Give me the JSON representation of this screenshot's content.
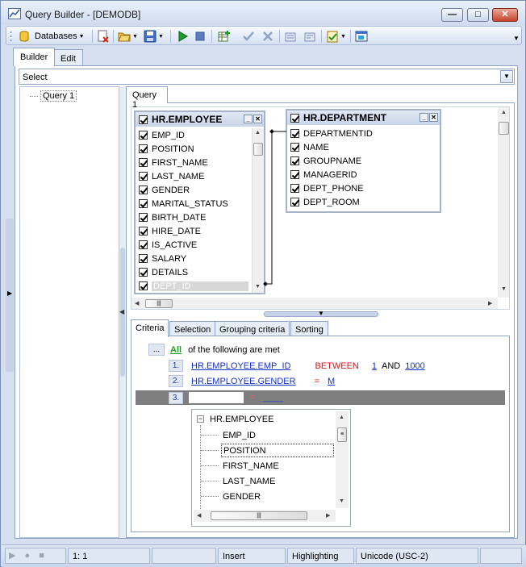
{
  "window": {
    "title": "Query Builder - [DEMODB]"
  },
  "caption_buttons": {
    "minimize": "—",
    "maximize": "□",
    "close": "✕"
  },
  "toolbar": {
    "databases_label": "Databases"
  },
  "main_tabs": [
    {
      "label": "Builder"
    },
    {
      "label": "Edit"
    }
  ],
  "query_type": {
    "value": "Select"
  },
  "query_tree": {
    "items": [
      {
        "label": "Query 1"
      }
    ]
  },
  "query_tab": {
    "label": "Query 1"
  },
  "tables": [
    {
      "title": "HR.EMPLOYEE",
      "fields": [
        "EMP_ID",
        "POSITION",
        "FIRST_NAME",
        "LAST_NAME",
        "GENDER",
        "MARITAL_STATUS",
        "BIRTH_DATE",
        "HIRE_DATE",
        "IS_ACTIVE",
        "SALARY",
        "DETAILS",
        "DEPT_ID"
      ]
    },
    {
      "title": "HR.DEPARTMENT",
      "fields": [
        "DEPARTMENTID",
        "NAME",
        "GROUPNAME",
        "MANAGERID",
        "DEPT_PHONE",
        "DEPT_ROOM"
      ]
    }
  ],
  "criteria_tabs": [
    {
      "label": "Criteria"
    },
    {
      "label": "Selection"
    },
    {
      "label": "Grouping criteria"
    },
    {
      "label": "Sorting"
    }
  ],
  "criteria": {
    "ellipsis": "...",
    "quantifier": "All",
    "tail": "of the following are met",
    "rows": [
      {
        "num": "1.",
        "field": "HR.EMPLOYEE.EMP_ID",
        "op": "BETWEEN",
        "v1": "1",
        "and": "AND",
        "v2": "1000"
      },
      {
        "num": "2.",
        "field": "HR.EMPLOYEE.GENDER",
        "op": "=",
        "v1": "M"
      },
      {
        "num": "3.",
        "field": "",
        "op": "=",
        "v1": "____"
      }
    ]
  },
  "field_dropdown": {
    "root": "HR.EMPLOYEE",
    "items": [
      "EMP_ID",
      "POSITION",
      "FIRST_NAME",
      "LAST_NAME",
      "GENDER"
    ],
    "selected": "POSITION"
  },
  "statusbar": {
    "position": "1:   1",
    "mode": "Insert",
    "highlighting": "Highlighting",
    "encoding": "Unicode (USC-2)"
  }
}
